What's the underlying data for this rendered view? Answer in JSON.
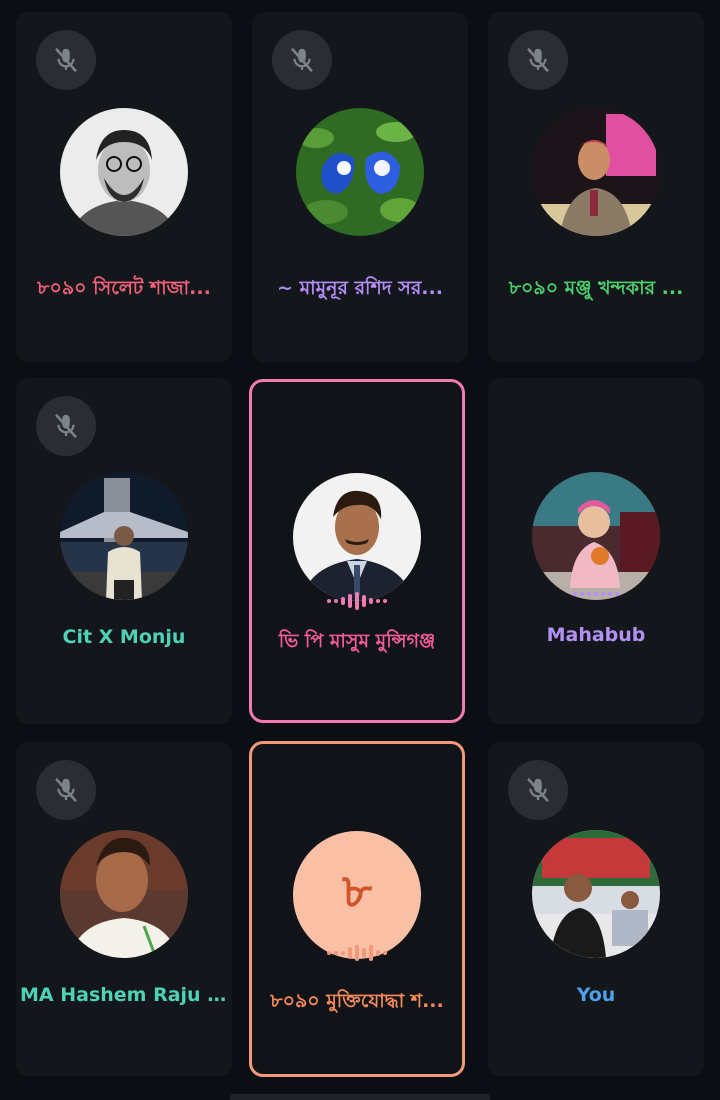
{
  "colors": {
    "page_bg": "#0b0e12",
    "tile_bg": "#13161b",
    "mute_bg": "#2a2e34",
    "mute_icon": "#7d838a"
  },
  "participants": [
    {
      "name": "৮০৯০ সিলেট শাজা...",
      "name_color": "#f0607a",
      "muted": true,
      "speaking": false,
      "avatar": "sketch-portrait"
    },
    {
      "name": "~ মামুনূর রশিদ সর...",
      "name_color": "#b38cf5",
      "muted": true,
      "speaking": false,
      "avatar": "blue-flowers"
    },
    {
      "name": "৮০৯০ মঞ্জু খন্দকার ...",
      "name_color": "#4bd06a",
      "muted": true,
      "speaking": false,
      "avatar": "man-at-podium"
    },
    {
      "name": "Cit X Monju",
      "name_color": "#4fd1b6",
      "muted": true,
      "speaking": false,
      "avatar": "tower-bridge-night"
    },
    {
      "name": "ভি পি মাসুম মুন্সিগঞ্জ",
      "name_color": "#f25c9a",
      "muted": false,
      "speaking": true,
      "avatar": "man-in-suit",
      "border_color": "#f07bb0"
    },
    {
      "name": "Mahabub",
      "name_color": "#b390f5",
      "muted": false,
      "speaking": false,
      "avatar": "child-photo"
    },
    {
      "name": "MA Hashem Raju ...",
      "name_color": "#4fd1b6",
      "muted": true,
      "speaking": false,
      "avatar": "smiling-man"
    },
    {
      "name": "৮০৯০ মুক্তিযোদ্ধা শ...",
      "name_color": "#f58a5c",
      "muted": false,
      "speaking": true,
      "avatar": "letter",
      "avatar_letter": "৮",
      "avatar_bg": "#f9c0a6",
      "avatar_fg": "#d0552a",
      "border_color": "#f1997a"
    },
    {
      "name": "You",
      "name_color": "#4ea0e8",
      "muted": true,
      "speaking": false,
      "avatar": "event-photo"
    }
  ]
}
